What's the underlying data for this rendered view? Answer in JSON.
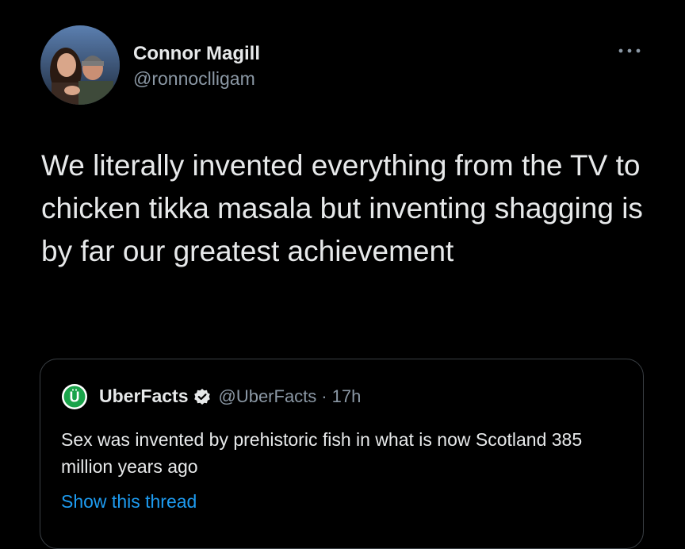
{
  "tweet": {
    "author_name": "Connor Magill",
    "author_handle": "@ronnoclligam",
    "avatar_icon": "profile-photo-avatar",
    "more_icon": "more-horizontal-icon",
    "text": "We literally invented everything from the TV to chicken tikka masala but inventing shagging is by far our greatest achievement"
  },
  "quoted_tweet": {
    "avatar_icon": "uberfacts-logo-icon",
    "avatar_letter": "Ü",
    "name": "UberFacts",
    "verified_icon": "verified-badge-icon",
    "handle": "@UberFacts",
    "separator": "·",
    "time": "17h",
    "text": "Sex was invented by prehistoric fish in what is now Scotland 385 million years ago",
    "show_thread_label": "Show this thread"
  },
  "colors": {
    "background": "#000000",
    "primary_text": "#e7e9ea",
    "secondary_text": "#8b98a5",
    "link": "#1d9bf0",
    "border": "#3a3f44",
    "brand_green": "#1aa34a"
  }
}
